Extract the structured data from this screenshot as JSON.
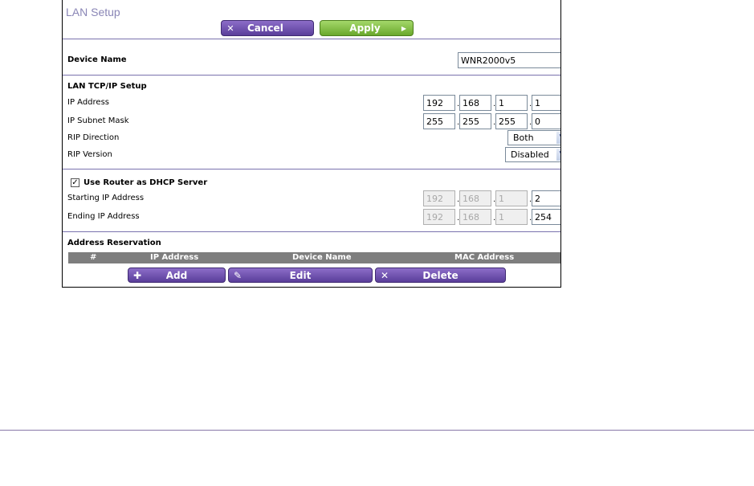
{
  "page_title": "LAN Setup",
  "buttons": {
    "cancel": "Cancel",
    "apply": "Apply",
    "add": "Add",
    "edit": "Edit",
    "delete": "Delete"
  },
  "device": {
    "label": "Device Name",
    "value": "WNR2000v5"
  },
  "lan_tcpip": {
    "heading": "LAN TCP/IP Setup",
    "ip_address_label": "IP Address",
    "ip_address": [
      "192",
      "168",
      "1",
      "1"
    ],
    "subnet_label": "IP Subnet Mask",
    "subnet": [
      "255",
      "255",
      "255",
      "0"
    ],
    "rip_direction_label": "RIP Direction",
    "rip_direction": "Both",
    "rip_version_label": "RIP Version",
    "rip_version": "Disabled"
  },
  "dhcp": {
    "checkbox_label": "Use Router as DHCP Server",
    "checked": true,
    "start_label": "Starting IP Address",
    "start_ip": [
      "192",
      "168",
      "1",
      "2"
    ],
    "end_label": "Ending IP Address",
    "end_ip": [
      "192",
      "168",
      "1",
      "254"
    ]
  },
  "reservation": {
    "heading": "Address Reservation",
    "columns": [
      "#",
      "IP Address",
      "Device Name",
      "MAC Address"
    ]
  },
  "icons": {
    "cancel": "close-icon",
    "apply": "arrow-right-icon",
    "add": "plus-icon",
    "edit": "pencil-icon",
    "delete": "close-icon",
    "select_arrow": "chevron-down-icon"
  },
  "colors": {
    "purple_button": "#6a4fb0",
    "green_button": "#86c04a",
    "title": "#8a86b6",
    "rule": "#7a72ae"
  }
}
